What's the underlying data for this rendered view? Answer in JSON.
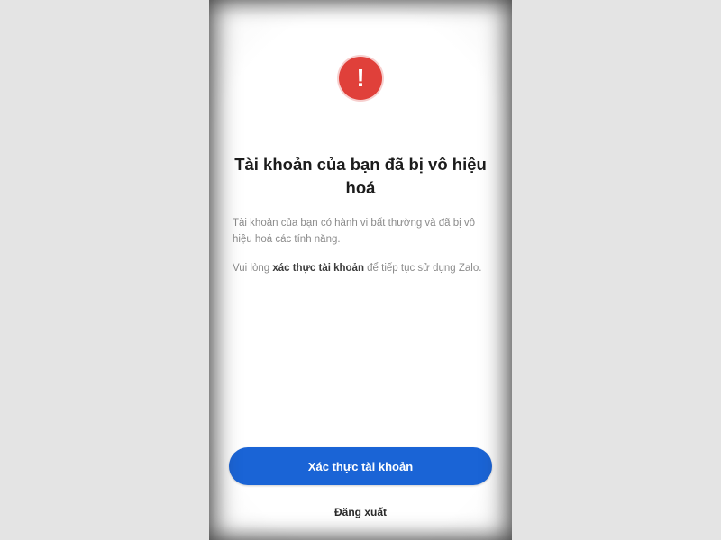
{
  "dialog": {
    "alert_icon": "exclamation-icon",
    "alert_glyph": "!",
    "title": "Tài khoản của bạn đã bị vô hiệu hoá",
    "description_1": "Tài khoản của bạn có hành vi bất thường và đã bị vô hiệu hoá các tính năng.",
    "description_2_prefix": "Vui lòng ",
    "description_2_bold": "xác thực tài khoản",
    "description_2_suffix": " để tiếp tục sử dụng Zalo.",
    "primary_button_label": "Xác thực tài khoản",
    "secondary_link_label": "Đăng xuất"
  },
  "colors": {
    "accent": "#1a64d6",
    "alert": "#e0403a",
    "background": "#e4e4e4"
  }
}
